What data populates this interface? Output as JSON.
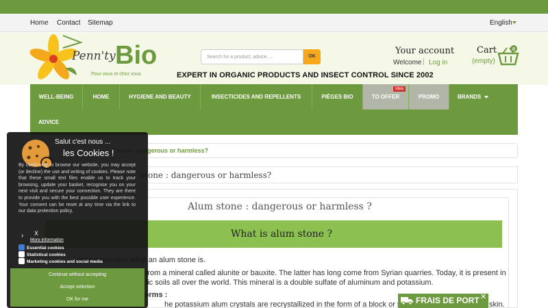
{
  "utilbar": {
    "home": "Home",
    "contact": "Contact",
    "sitemap": "Sitemap",
    "language": "English"
  },
  "logo": {
    "penny": "Penn'ty",
    "bio": "Bio",
    "tagline": "Pour vous et chez vous"
  },
  "search": {
    "placeholder": "Search for a product, advice....",
    "button": "OK"
  },
  "tagline": "EXPERT IN ORGANIC PRODUCTS AND INSECT CONTROL SINCE 2002",
  "account": {
    "title": "Your account",
    "welcome": "Welcome",
    "separator": "|",
    "login": "Log in"
  },
  "cart": {
    "title": "Cart",
    "status": "(empty)",
    "count": "0"
  },
  "nav": {
    "items": [
      "WELL-BEING",
      "HOME",
      "HYGIENE AND BEAUTY",
      "INSECTICIDES AND REPELLENTS",
      "PIÈGES BIO",
      "TO OFFER",
      "PROMO",
      "BRANDS",
      "ADVICE"
    ],
    "badge": "Idea"
  },
  "breadcrumb": "stone, dangerous or harmless?",
  "page_title": "stone : dangerous or harmless?",
  "article": {
    "title": "Alum stone : dangerous or harmless ?",
    "heading": "What is alum stone ?",
    "p1": "let's remember what an alum stone is.",
    "p2": "d from a mineral called alunite or bauxite. The latter has long come from Syrian quarries. Today, it is present in",
    "p3": "anic soils all over the world. This mineral is a double sulfate of aluminum and potassium.",
    "p4": "forms :",
    "p5": "he potassium alum crystals are recrystallized in the form of a block or stick that",
    "p5_end": "skin."
  },
  "free_shipping": {
    "label": "FRAIS DE PORT",
    "close": "✕"
  },
  "cookie": {
    "salut": "Salut c'est nous ...",
    "title": "les Cookies !",
    "body": "By continuing to browse our website, you may accept (or decline) the use and writing of cookies. Please note that these small text files enable us to track your browsing, update your basket, recognise you on your next visit and secure your connection. They are there to provide you with the best possible user experience. Your consent can be reset at any time via the link to our data protection policy.",
    "more": "More information",
    "x": "X",
    "chevron": "›",
    "options": [
      "Essential cookies",
      "Statistical cookies",
      "Marketing cookies and social media"
    ],
    "btn_continue": "Continue without accepting",
    "btn_accept": "Accept selection",
    "btn_ok": "OK for me"
  },
  "colors": {
    "brand_green": "#6e9a3f",
    "light_green": "#8cc152",
    "accent_orange": "#f7a81b"
  }
}
